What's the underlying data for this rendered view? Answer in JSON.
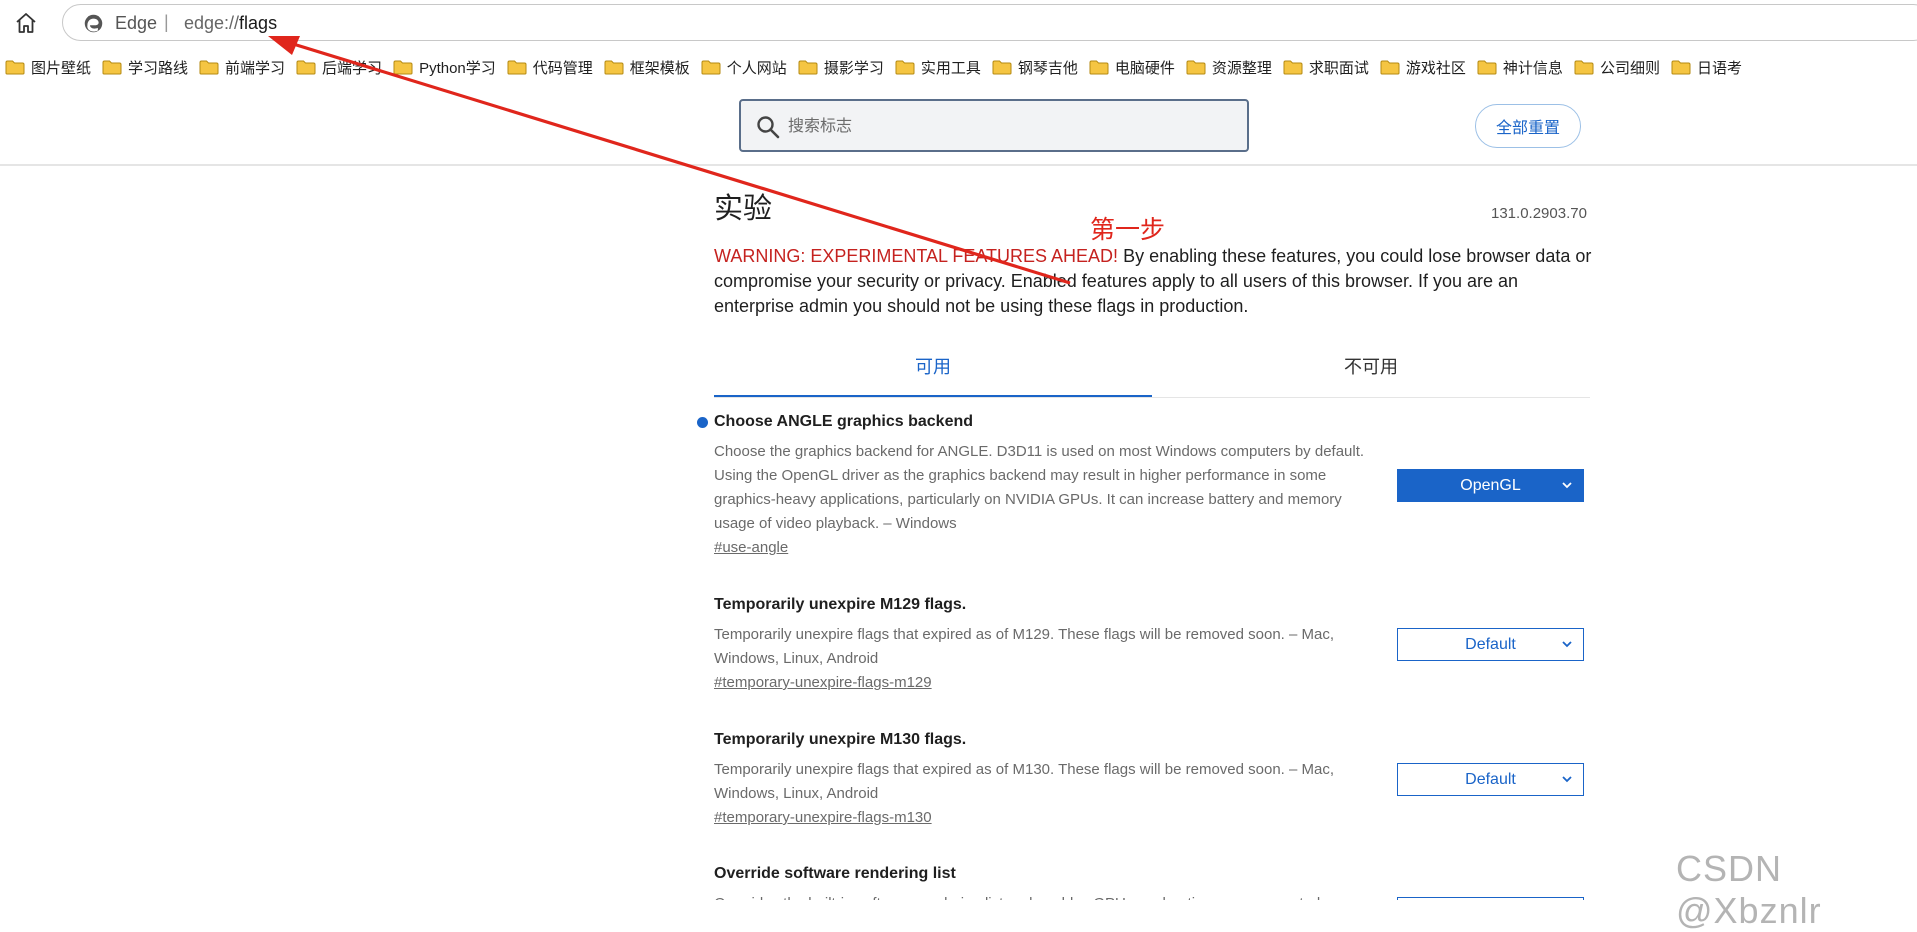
{
  "browser": {
    "site_name": "Edge",
    "separator": "|",
    "url_prefix": "edge://",
    "url_path": "flags"
  },
  "bookmarks": [
    {
      "label": "图片壁纸",
      "icon": "folder-icon"
    },
    {
      "label": "学习路线",
      "icon": "folder-icon"
    },
    {
      "label": "前端学习",
      "icon": "folder-icon"
    },
    {
      "label": "后端学习",
      "icon": "folder-icon"
    },
    {
      "label": "Python学习",
      "icon": "folder-icon"
    },
    {
      "label": "代码管理",
      "icon": "folder-icon"
    },
    {
      "label": "框架模板",
      "icon": "folder-icon"
    },
    {
      "label": "个人网站",
      "icon": "folder-icon"
    },
    {
      "label": "摄影学习",
      "icon": "folder-icon"
    },
    {
      "label": "实用工具",
      "icon": "folder-icon"
    },
    {
      "label": "钢琴吉他",
      "icon": "folder-icon"
    },
    {
      "label": "电脑硬件",
      "icon": "folder-icon"
    },
    {
      "label": "资源整理",
      "icon": "folder-icon"
    },
    {
      "label": "求职面试",
      "icon": "folder-icon"
    },
    {
      "label": "游戏社区",
      "icon": "folder-icon"
    },
    {
      "label": "神计信息",
      "icon": "folder-icon"
    },
    {
      "label": "公司细则",
      "icon": "folder-icon"
    },
    {
      "label": "日语考",
      "icon": "folder-icon"
    }
  ],
  "header": {
    "search_placeholder": "搜索标志",
    "reset_all": "全部重置"
  },
  "page": {
    "title": "实验",
    "version": "131.0.2903.70",
    "warning_label": "WARNING: EXPERIMENTAL FEATURES AHEAD!",
    "warning_text": " By enabling these features, you could lose browser data or compromise your security or privacy. Enabled features apply to all users of this browser. If you are an enterprise admin you should not be using these flags in production.",
    "tabs": {
      "available": "可用",
      "unavailable": "不可用"
    }
  },
  "flags": [
    {
      "title": "Choose ANGLE graphics backend",
      "description": "Choose the graphics backend for ANGLE. D3D11 is used on most Windows computers by default. Using the OpenGL driver as the graphics backend may result in higher performance in some graphics-heavy applications, particularly on NVIDIA GPUs. It can increase battery and memory usage of video playback. – Windows",
      "link": "#use-angle",
      "value": "OpenGL",
      "modified": true
    },
    {
      "title": "Temporarily unexpire M129 flags.",
      "description": "Temporarily unexpire flags that expired as of M129. These flags will be removed soon. – Mac, Windows, Linux, Android",
      "link": "#temporary-unexpire-flags-m129",
      "value": "Default",
      "modified": false
    },
    {
      "title": "Temporarily unexpire M130 flags.",
      "description": "Temporarily unexpire flags that expired as of M130. These flags will be removed soon. – Mac, Windows, Linux, Android",
      "link": "#temporary-unexpire-flags-m130",
      "value": "Default",
      "modified": false
    },
    {
      "title": "Override software rendering list",
      "description": "Overrides the built-in software rendering list and enables GPU-acceleration on unsupported",
      "link": "",
      "value": "",
      "modified": false
    }
  ],
  "annotation": {
    "label": "第一步",
    "color": "#e0261c"
  },
  "watermark": "CSDN @Xbznlr",
  "colors": {
    "accent": "#1a64c8",
    "warning": "#c5221f",
    "folder": "#f5c542"
  }
}
